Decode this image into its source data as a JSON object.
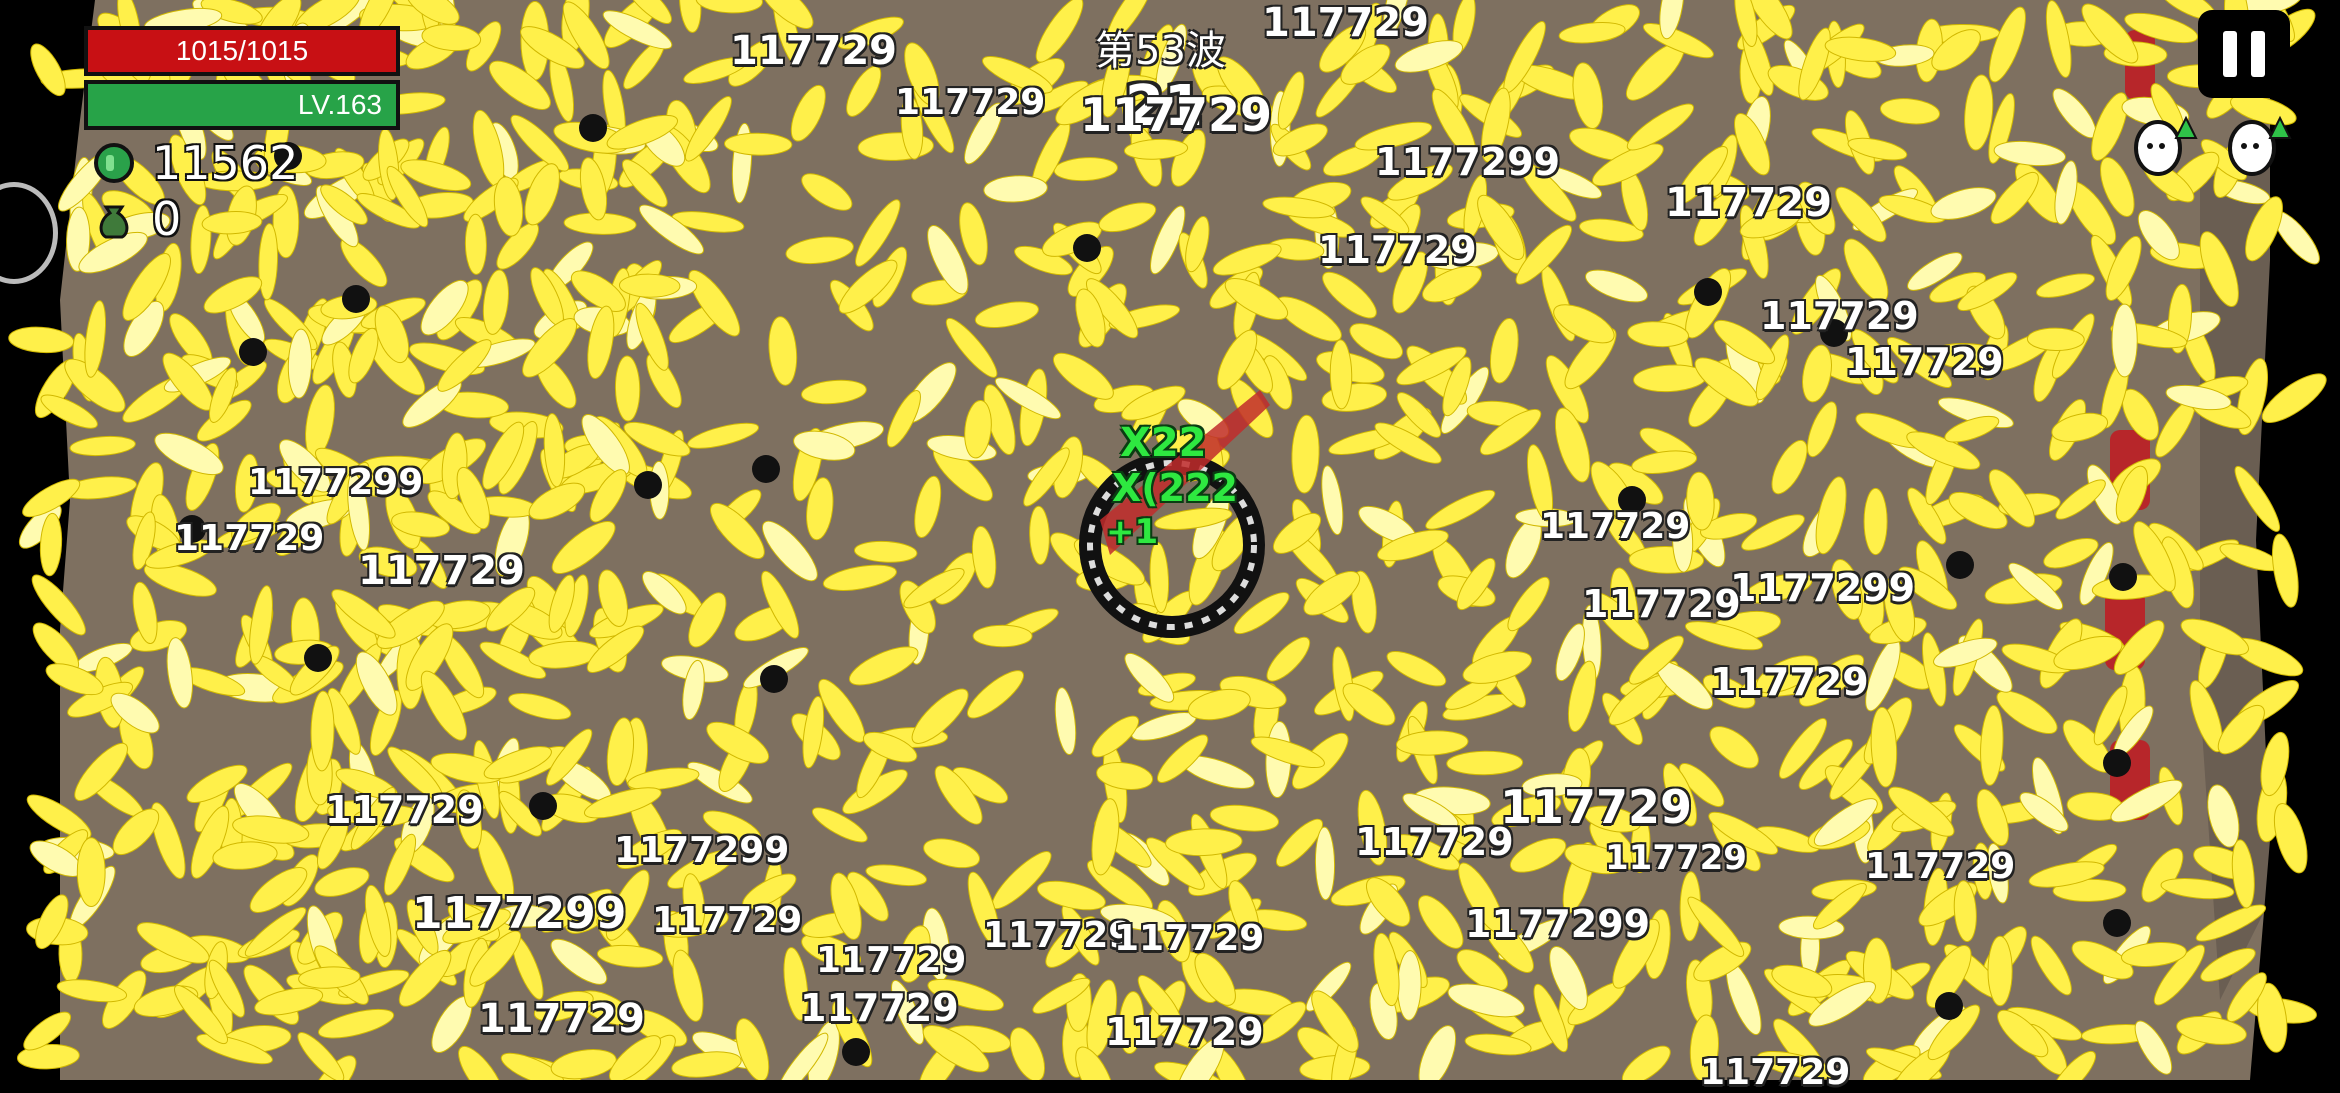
{
  "hud": {
    "hp_text": "1015/1015",
    "level_text": "LV.163",
    "gems": "11562",
    "bag_items": "0",
    "wave": "第53波",
    "timer": "21",
    "hp_fraction": 1.0
  },
  "colors": {
    "arena_floor": "#7e7060",
    "bullet_yellow": "#fff04a",
    "hp_red": "#c81014",
    "xp_green": "#27a348",
    "combo_green": "#2ee840"
  },
  "icons": {
    "gem": "green-gem-icon",
    "bag": "money-bag-icon",
    "pause": "pause-icon",
    "upgrade": "egg-upgrade-icon",
    "side": "skill-button-icon"
  },
  "combo": {
    "line1": "X22",
    "line2": "X(222",
    "line3": "+1"
  },
  "damage_numbers": [
    "117729",
    "117729",
    "117729",
    "117729",
    "1177299",
    "117729",
    "117729",
    "117729",
    "117729",
    "1177299",
    "117729",
    "117729",
    "117729",
    "1177299",
    "117729",
    "117729",
    "117729",
    "117729",
    "117729",
    "1177299",
    "117729",
    "117729",
    "1177299",
    "117729",
    "1177299",
    "117729",
    "117729",
    "117729",
    "117729",
    "117729",
    "117729",
    "117729"
  ]
}
